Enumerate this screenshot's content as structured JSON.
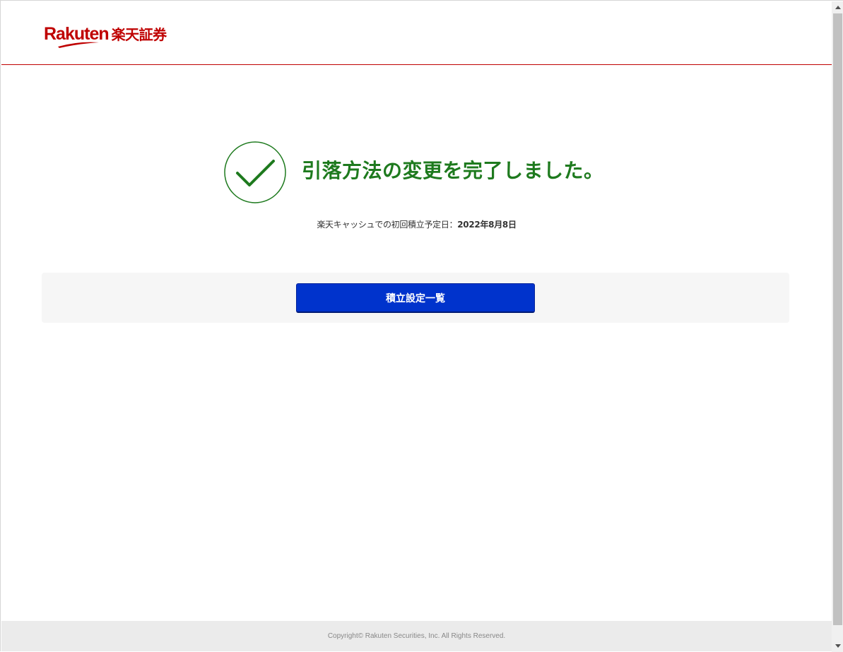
{
  "header": {
    "logo_en": "Rakuten",
    "logo_jp": "楽天証券"
  },
  "completion": {
    "title": "引落方法の変更を完了しました。",
    "schedule_label": "楽天キャッシュでの初回積立予定日：",
    "schedule_date": "2022年8月8日"
  },
  "actions": {
    "primary_label": "積立設定一覧"
  },
  "footer": {
    "copyright": "Copyright© Rakuten Securities, Inc. All Rights Reserved."
  },
  "icons": {
    "check": "check-circle-icon",
    "scroll_up": "scroll-up-arrow-icon",
    "scroll_down": "scroll-down-arrow-icon"
  },
  "colors": {
    "brand": "#bf0000",
    "success": "#1e7a1e",
    "primary_button": "#0033cc",
    "footer_bg": "#ebebeb"
  }
}
